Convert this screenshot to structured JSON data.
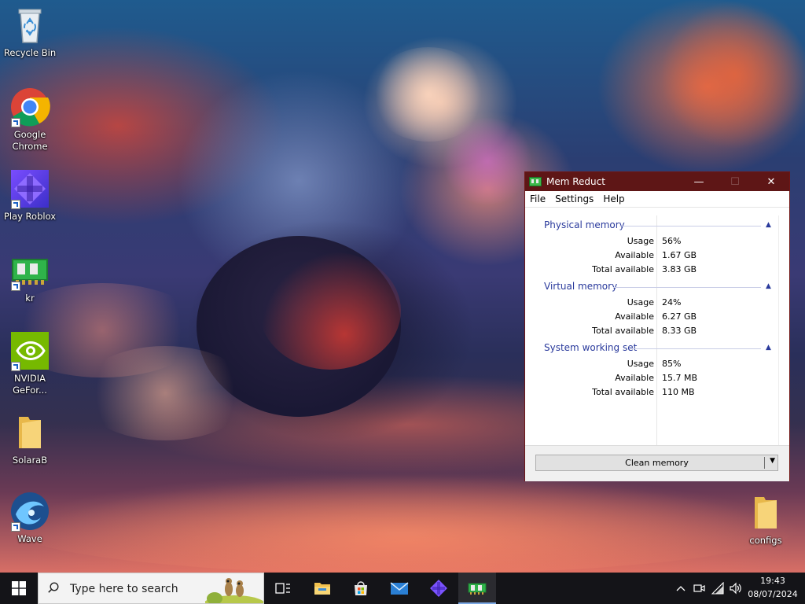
{
  "desktop": {
    "icons": [
      {
        "label": "Recycle Bin",
        "icon": "recycle-bin-icon"
      },
      {
        "label": "Google Chrome",
        "icon": "chrome-icon"
      },
      {
        "label": "Play Roblox",
        "icon": "roblox-icon"
      },
      {
        "label": "kr",
        "icon": "mem-reduct-icon"
      },
      {
        "label": "NVIDIA GeFor...",
        "icon": "nvidia-icon"
      },
      {
        "label": "SolaraB",
        "icon": "folder-icon"
      },
      {
        "label": "Wave",
        "icon": "wave-icon"
      },
      {
        "label": "configs",
        "icon": "folder-icon"
      }
    ]
  },
  "window": {
    "title": "Mem Reduct",
    "controls": {
      "minimize": "—",
      "maximize": "☐",
      "close": "✕"
    },
    "menu": [
      "File",
      "Settings",
      "Help"
    ],
    "groups": [
      {
        "title": "Physical memory",
        "rows": [
          {
            "key": "Usage",
            "value": "56%"
          },
          {
            "key": "Available",
            "value": "1.67 GB"
          },
          {
            "key": "Total available",
            "value": "3.83 GB"
          }
        ]
      },
      {
        "title": "Virtual memory",
        "rows": [
          {
            "key": "Usage",
            "value": "24%"
          },
          {
            "key": "Available",
            "value": "6.27 GB"
          },
          {
            "key": "Total available",
            "value": "8.33 GB"
          }
        ]
      },
      {
        "title": "System working set",
        "rows": [
          {
            "key": "Usage",
            "value": "85%"
          },
          {
            "key": "Available",
            "value": "15.7 MB"
          },
          {
            "key": "Total available",
            "value": "110 MB"
          }
        ]
      }
    ],
    "clean_button": "Clean memory",
    "accent": "#5e1616",
    "group_color": "#2a3a9c"
  },
  "taskbar": {
    "search_placeholder": "Type here to search",
    "pinned": [
      "task-view-icon",
      "file-explorer-icon",
      "microsoft-store-icon",
      "mail-icon",
      "roblox-icon",
      "mem-reduct-icon"
    ],
    "active": "mem-reduct-icon",
    "tray": [
      "chevron-up-icon",
      "meet-now-icon",
      "network-icon",
      "volume-icon"
    ],
    "time": "19:43",
    "date": "08/07/2024"
  }
}
